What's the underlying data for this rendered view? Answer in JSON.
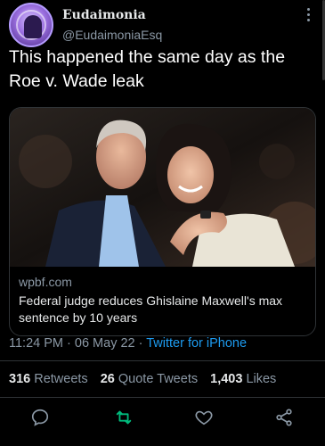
{
  "tweet": {
    "author": {
      "name": "Eudaimonia",
      "handle": "@EudaimoniaEsq",
      "avatar_icon": "profile-avatar"
    },
    "text": "This happened the same day as the Roe v. Wade leak",
    "link_card": {
      "domain": "wpbf.com",
      "title": "Federal judge reduces Ghislaine Maxwell's max sentence by 10 years"
    },
    "meta": {
      "time": "11:24 PM",
      "separator1": " · ",
      "date": "06 May 22",
      "separator2": " · ",
      "source": "Twitter for iPhone"
    },
    "stats": {
      "retweets_count": "316",
      "retweets_label": "Retweets",
      "quotes_count": "26",
      "quotes_label": "Quote Tweets",
      "likes_count": "1,403",
      "likes_label": "Likes"
    },
    "actions": [
      "reply-icon",
      "retweet-icon",
      "like-icon",
      "share-icon"
    ]
  },
  "colors": {
    "background": "#000000",
    "text_primary": "#e7e9ea",
    "text_secondary": "#8b98a5",
    "link_blue": "#1d9bf0",
    "retweet_green": "#00ba7c",
    "divider": "#2f3336"
  }
}
